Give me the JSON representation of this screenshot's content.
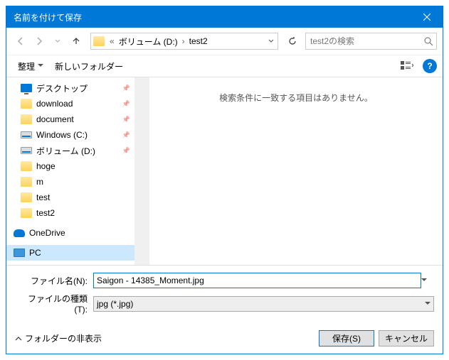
{
  "title": "名前を付けて保存",
  "breadcrumb": {
    "root": "ボリューム (D:)",
    "folder": "test2"
  },
  "search": {
    "placeholder": "test2の検索"
  },
  "toolbar": {
    "organize": "整理",
    "newfolder": "新しいフォルダー"
  },
  "tree": {
    "items": [
      {
        "label": "デスクトップ",
        "icon": "desktop",
        "pinned": true
      },
      {
        "label": "download",
        "icon": "folder",
        "pinned": true
      },
      {
        "label": "document",
        "icon": "folder",
        "pinned": true
      },
      {
        "label": "Windows (C:)",
        "icon": "disk",
        "pinned": true
      },
      {
        "label": "ボリューム (D:)",
        "icon": "disk",
        "pinned": true
      },
      {
        "label": "hoge",
        "icon": "folder",
        "pinned": false
      },
      {
        "label": "m",
        "icon": "folder",
        "pinned": false
      },
      {
        "label": "test",
        "icon": "folder",
        "pinned": false
      },
      {
        "label": "test2",
        "icon": "folder",
        "pinned": false
      }
    ],
    "onedrive": "OneDrive",
    "pc": "PC"
  },
  "filearea": {
    "empty": "検索条件に一致する項目はありません。"
  },
  "fields": {
    "filename_label": "ファイル名(N):",
    "filename_value": "Saigon - 14385_Moment.jpg",
    "filetype_label": "ファイルの種類(T):",
    "filetype_value": "jpg (*.jpg)"
  },
  "footer": {
    "expand": "フォルダーの非表示",
    "save": "保存(S)",
    "cancel": "キャンセル"
  }
}
